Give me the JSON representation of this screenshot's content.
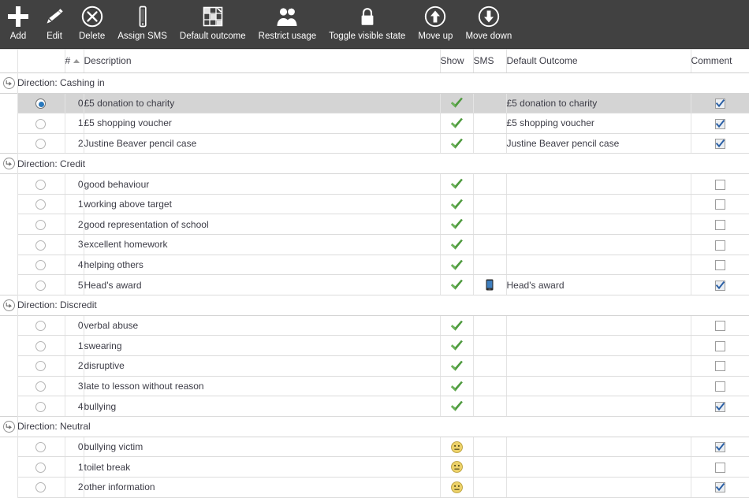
{
  "toolbar": {
    "items": [
      {
        "label": "Add",
        "icon": "plus-icon"
      },
      {
        "label": "Edit",
        "icon": "pencil-icon"
      },
      {
        "label": "Delete",
        "icon": "delete-circle-x-icon"
      },
      {
        "label": "Assign SMS",
        "icon": "mobile-phone-icon"
      },
      {
        "label": "Default outcome",
        "icon": "grid-table-icon"
      },
      {
        "label": "Restrict usage",
        "icon": "users-group-icon"
      },
      {
        "label": "Toggle visible state",
        "icon": "padlock-icon"
      },
      {
        "label": "Move up",
        "icon": "arrow-up-circle-icon"
      },
      {
        "label": "Move down",
        "icon": "arrow-down-circle-icon"
      }
    ]
  },
  "grid": {
    "columns": {
      "indicator": "",
      "select": "",
      "number": "#",
      "description": "Description",
      "show": "Show",
      "sms": "SMS",
      "default_outcome": "Default Outcome",
      "comment": "Comment"
    },
    "sort": {
      "column": "#",
      "direction": "ascending"
    },
    "groups": [
      {
        "label": "Direction: Cashing in",
        "expanded": true,
        "rows": [
          {
            "selected": true,
            "number": "0",
            "description": "£5 donation to charity",
            "show": "tick",
            "sms": "",
            "default_outcome": "£5 donation to charity",
            "comment": true
          },
          {
            "selected": false,
            "number": "1",
            "description": "£5 shopping voucher",
            "show": "tick",
            "sms": "",
            "default_outcome": "£5 shopping voucher",
            "comment": true
          },
          {
            "selected": false,
            "number": "2",
            "description": "Justine Beaver pencil case",
            "show": "tick",
            "sms": "",
            "default_outcome": "Justine Beaver pencil case",
            "comment": true
          }
        ]
      },
      {
        "label": "Direction: Credit",
        "expanded": true,
        "rows": [
          {
            "selected": false,
            "number": "0",
            "description": "good behaviour",
            "show": "tick",
            "sms": "",
            "default_outcome": "",
            "comment": false
          },
          {
            "selected": false,
            "number": "1",
            "description": "working above target",
            "show": "tick",
            "sms": "",
            "default_outcome": "",
            "comment": false
          },
          {
            "selected": false,
            "number": "2",
            "description": "good representation of school",
            "show": "tick",
            "sms": "",
            "default_outcome": "",
            "comment": false
          },
          {
            "selected": false,
            "number": "3",
            "description": "excellent homework",
            "show": "tick",
            "sms": "",
            "default_outcome": "",
            "comment": false
          },
          {
            "selected": false,
            "number": "4",
            "description": "helping others",
            "show": "tick",
            "sms": "",
            "default_outcome": "",
            "comment": false
          },
          {
            "selected": false,
            "number": "5",
            "description": "Head's award",
            "show": "tick",
            "sms": "phone",
            "default_outcome": "Head's award",
            "comment": true
          }
        ]
      },
      {
        "label": "Direction: Discredit",
        "expanded": true,
        "rows": [
          {
            "selected": false,
            "number": "0",
            "description": "verbal abuse",
            "show": "tick",
            "sms": "",
            "default_outcome": "",
            "comment": false
          },
          {
            "selected": false,
            "number": "1",
            "description": "swearing",
            "show": "tick",
            "sms": "",
            "default_outcome": "",
            "comment": false
          },
          {
            "selected": false,
            "number": "2",
            "description": "disruptive",
            "show": "tick",
            "sms": "",
            "default_outcome": "",
            "comment": false
          },
          {
            "selected": false,
            "number": "3",
            "description": "late to lesson without reason",
            "show": "tick",
            "sms": "",
            "default_outcome": "",
            "comment": false
          },
          {
            "selected": false,
            "number": "4",
            "description": "bullying",
            "show": "tick",
            "sms": "",
            "default_outcome": "",
            "comment": true
          }
        ]
      },
      {
        "label": "Direction: Neutral",
        "expanded": true,
        "rows": [
          {
            "selected": false,
            "number": "0",
            "description": "bullying victim",
            "show": "face",
            "sms": "",
            "default_outcome": "",
            "comment": true
          },
          {
            "selected": false,
            "number": "1",
            "description": "toilet break",
            "show": "face",
            "sms": "",
            "default_outcome": "",
            "comment": false
          },
          {
            "selected": false,
            "number": "2",
            "description": "other information",
            "show": "face",
            "sms": "",
            "default_outcome": "",
            "comment": true
          }
        ]
      }
    ]
  },
  "colors": {
    "toolbar_bg": "#414141",
    "toolbar_text": "#ffffff",
    "tick_green": "#4e9a3e",
    "neutral_face": "#ecd169",
    "radio_blue": "#2878bd",
    "check_blue": "#2a5fa5",
    "selected_row": "#d4d4d4",
    "grid_line": "#dcdcdc",
    "text": "#3c3c46"
  }
}
